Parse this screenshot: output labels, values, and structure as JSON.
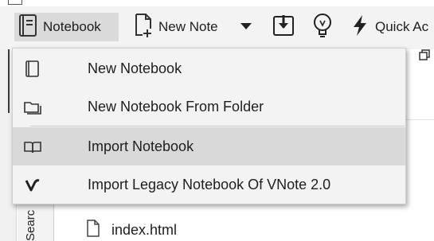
{
  "toolbar": {
    "notebook_label": "Notebook",
    "new_note_label": "New Note",
    "quick_access_label": "Quick Ac"
  },
  "menu": {
    "items": [
      {
        "label": "New Notebook",
        "icon": "notebook-icon"
      },
      {
        "label": "New Notebook From Folder",
        "icon": "folder-icon"
      },
      {
        "label": "Import Notebook",
        "icon": "open-book-icon"
      },
      {
        "label": "Import Legacy Notebook Of VNote 2.0",
        "icon": "vnote-logo-icon"
      }
    ],
    "highlighted_index": 2
  },
  "side_panel": {
    "tab_label": "Searc"
  },
  "files": [
    {
      "name": "index.html"
    }
  ],
  "colors": {
    "toolbar_bg": "#f3f3f3",
    "menu_bg": "#f3f3f3",
    "highlight": "#d9d9d9",
    "pressed_button": "#dadada"
  }
}
